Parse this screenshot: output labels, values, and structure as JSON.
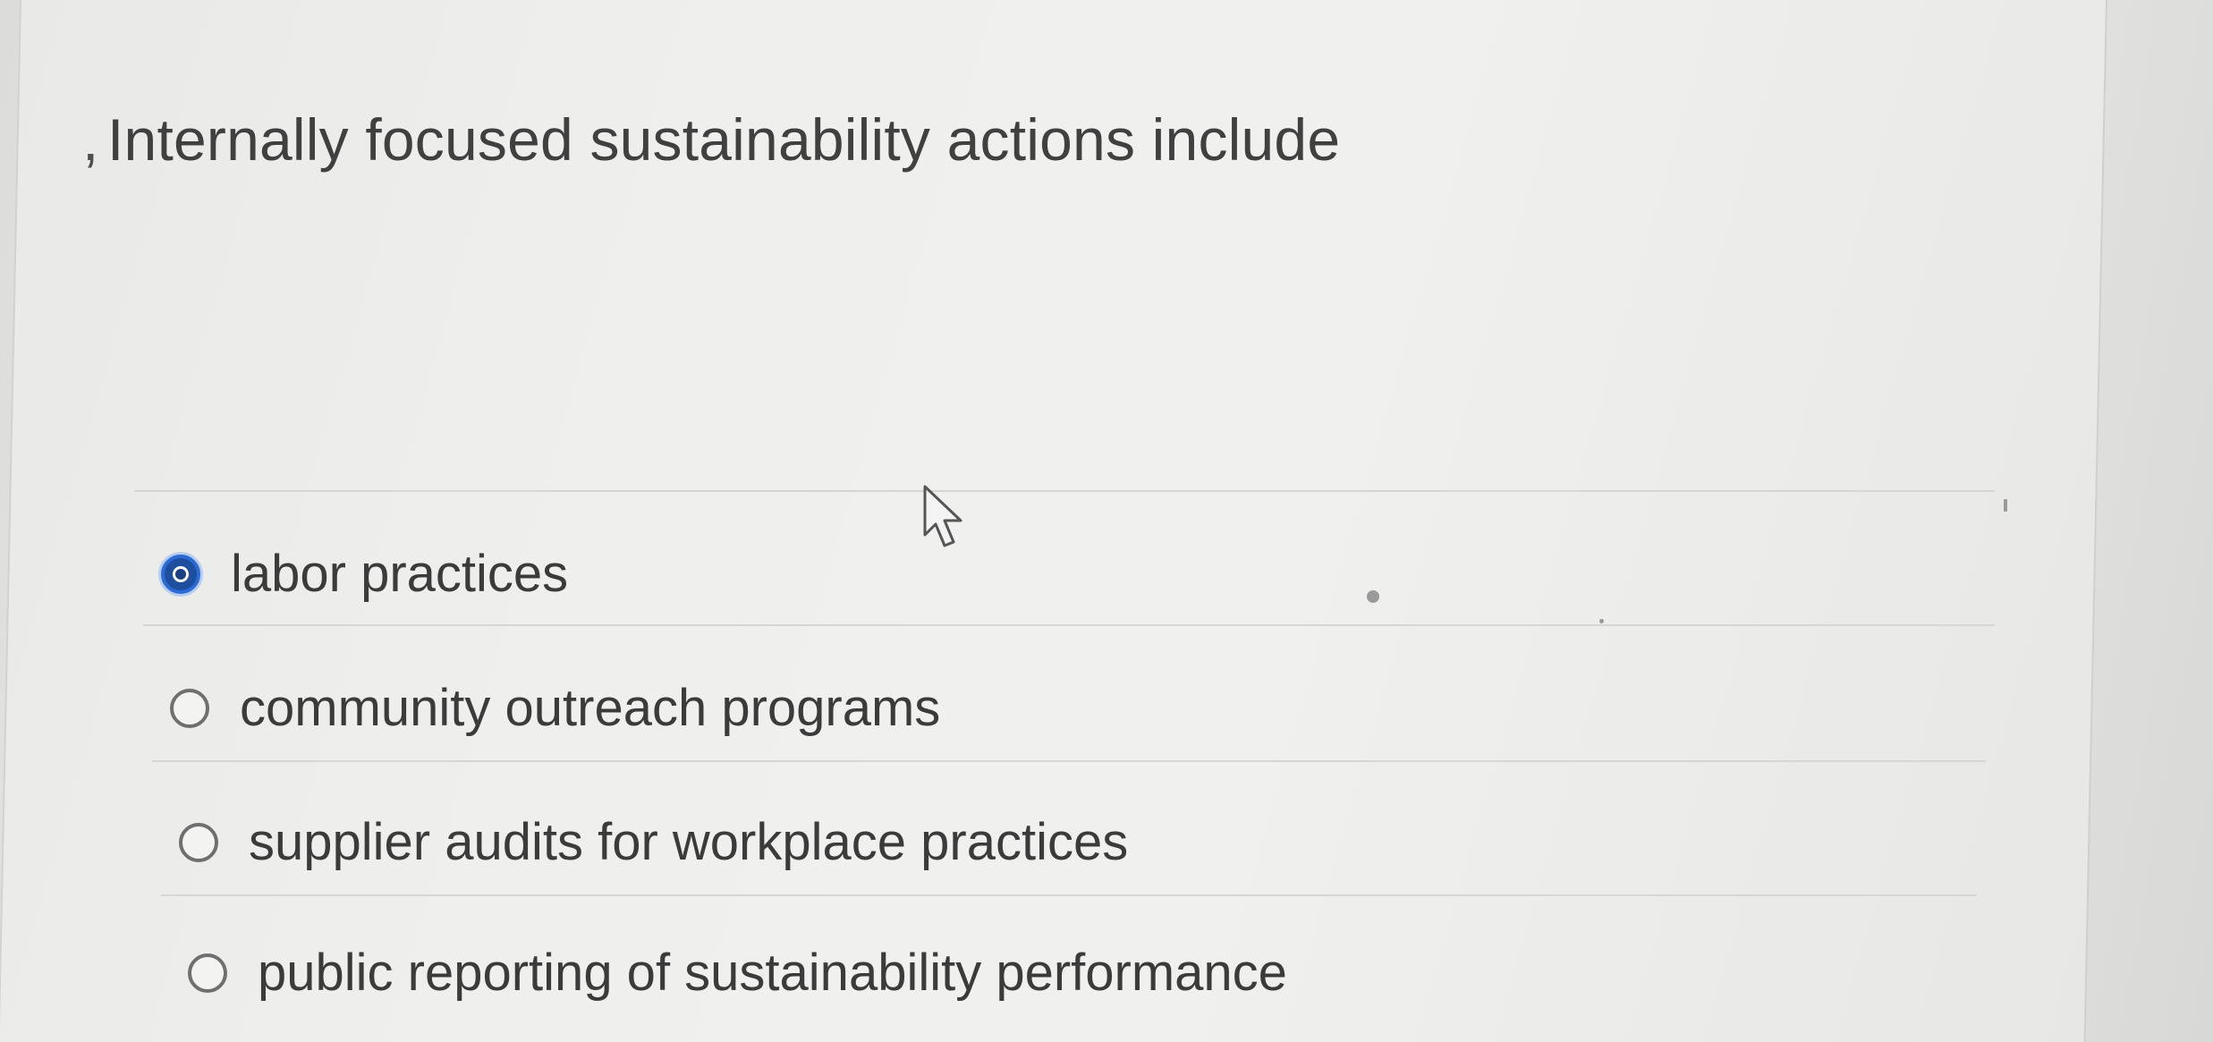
{
  "question": {
    "mark": ",",
    "text": "Internally focused sustainability actions include"
  },
  "options": [
    {
      "label": "labor practices",
      "selected": true
    },
    {
      "label": "community outreach programs",
      "selected": false
    },
    {
      "label": "supplier audits for workplace practices",
      "selected": false
    },
    {
      "label": "public reporting of sustainability performance",
      "selected": false
    }
  ],
  "colors": {
    "selected_radio": "#2c6ad6",
    "text": "#3b3b3b",
    "background": "#efefed"
  },
  "icons": {
    "cursor": "mouse-pointer-icon"
  }
}
